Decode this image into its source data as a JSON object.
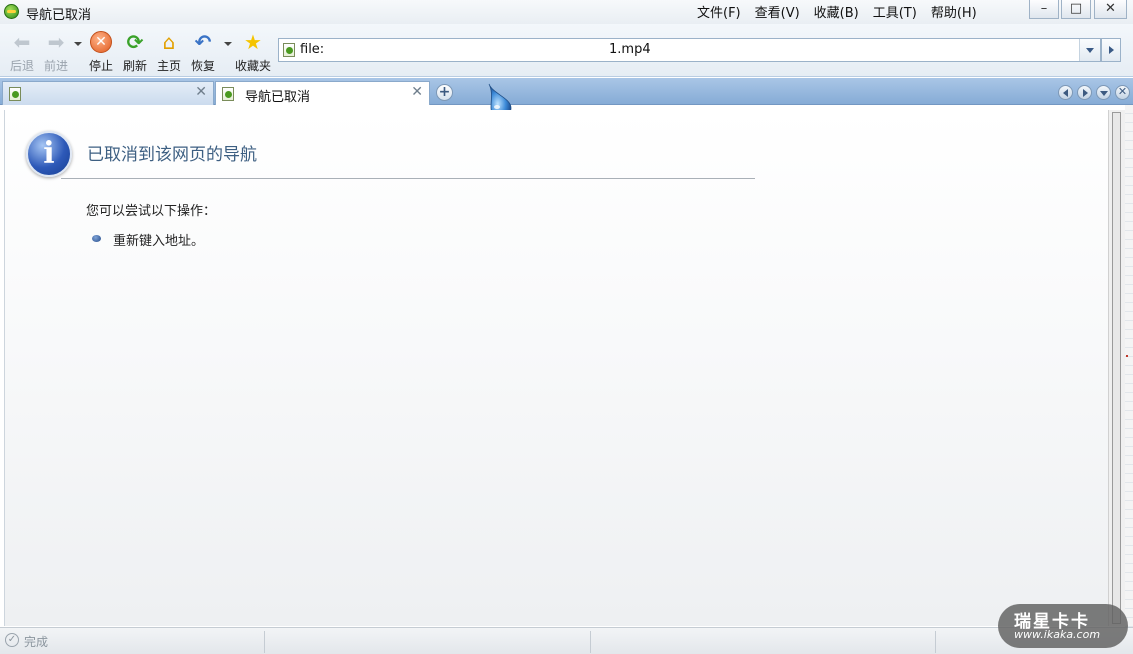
{
  "window": {
    "title": "导航已取消",
    "minimize_icon": "minimize-icon",
    "maximize_icon": "maximize-icon",
    "close_icon": "close-icon"
  },
  "menu": {
    "items": [
      "文件(F)",
      "查看(V)",
      "收藏(B)",
      "工具(T)",
      "帮助(H)"
    ]
  },
  "toolbar": {
    "back_label": "后退",
    "forward_label": "前进",
    "stop_label": "停止",
    "refresh_label": "刷新",
    "home_label": "主页",
    "restore_label": "恢复",
    "favorites_label": "收藏夹"
  },
  "address": {
    "prefix": "file:",
    "filename": "1.mp4"
  },
  "tabs": [
    {
      "title": "",
      "active": false
    },
    {
      "title": "导航已取消",
      "active": true
    }
  ],
  "content": {
    "heading": "已取消到该网页的导航",
    "hint": "您可以尝试以下操作：",
    "actions": [
      "重新键入地址。"
    ]
  },
  "status": {
    "text": "完成"
  },
  "watermark": {
    "main": "瑞星卡卡",
    "url": "www.ikaka.com"
  },
  "colors": {
    "tabstrip": "#9ebde0",
    "heading": "#3d5f82",
    "info_icon": "#2d59b8"
  }
}
